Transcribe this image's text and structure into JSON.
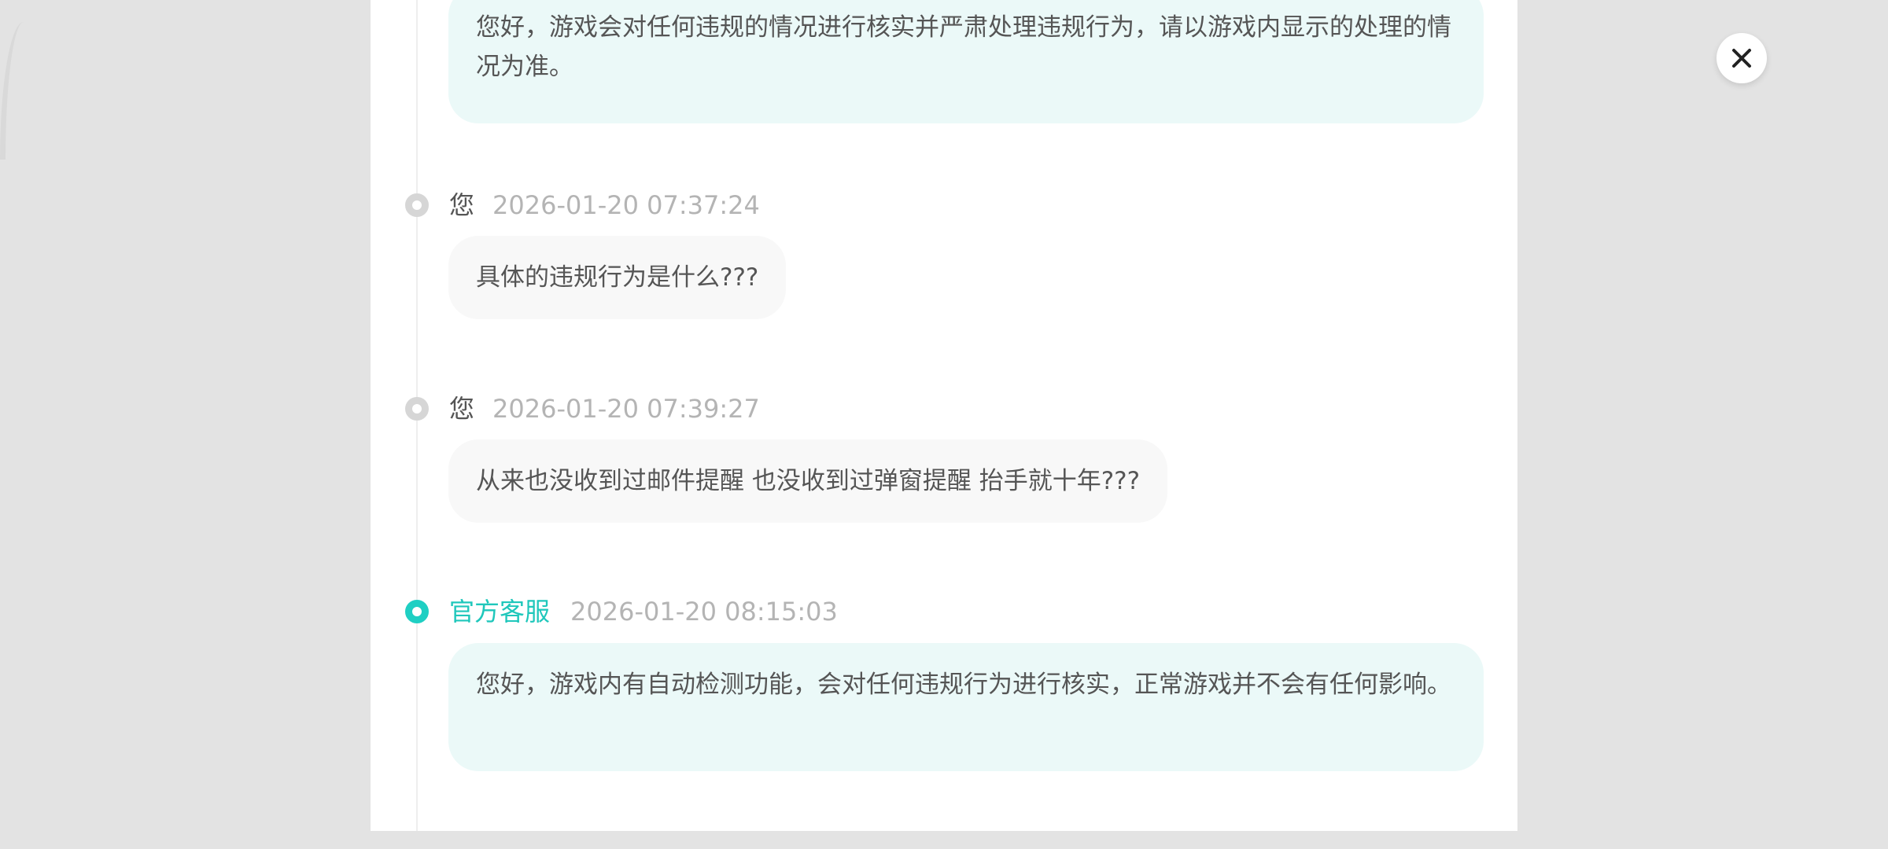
{
  "conversation": {
    "messages": [
      {
        "role": "agent",
        "sender": "",
        "time": "",
        "text": "您好，游戏会对任何违规的情况进行核实并严肃处理违规行为，请以游戏内显示的处理的情况为准。"
      },
      {
        "role": "user",
        "sender": "您",
        "time": "2026-01-20 07:37:24",
        "text": "具体的违规行为是什么???"
      },
      {
        "role": "user",
        "sender": "您",
        "time": "2026-01-20 07:39:27",
        "text": "从来也没收到过邮件提醒 也没收到过弹窗提醒 抬手就十年???"
      },
      {
        "role": "agent",
        "sender": "官方客服",
        "time": "2026-01-20 08:15:03",
        "text": "您好，游戏内有自动检测功能，会对任何违规行为进行核实，正常游戏并不会有任何影响。"
      }
    ]
  },
  "close_button": {
    "icon": "close-icon"
  },
  "colors": {
    "accent": "#1fc7bb",
    "agent_bubble": "#ebf9f8",
    "user_bubble": "#f8f8f8",
    "backdrop": "#e3e3e3"
  }
}
